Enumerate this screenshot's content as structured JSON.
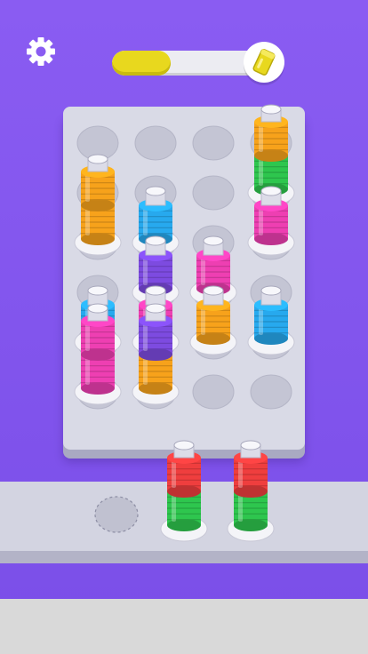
{
  "game": "color ring sort",
  "level_progress": 0.36,
  "colors": {
    "background": "#8a5cf2",
    "board": "#d9dae6",
    "hole": "#c4c5d4",
    "peg": "#dcdce8",
    "orange": "#f7a21b",
    "cyan": "#27a9ee",
    "magenta": "#ee3fb2",
    "purple": "#7d4be0",
    "green": "#2ec64e",
    "red": "#ef3e3e",
    "yellow": "#e8d81e"
  },
  "icons": {
    "settings": "gear-icon",
    "progress_badge": "paint-bucket-icon"
  },
  "board": {
    "columns": 4,
    "rows": 6,
    "pegs": [
      {
        "col": 0,
        "row": 1,
        "stack": [
          "orange",
          "orange"
        ]
      },
      {
        "col": 1,
        "row": 1,
        "stack": [
          "cyan"
        ]
      },
      {
        "col": 3,
        "row": 0,
        "stack": [
          "green",
          "orange"
        ]
      },
      {
        "col": 3,
        "row": 1,
        "stack": [
          "magenta"
        ]
      },
      {
        "col": 1,
        "row": 2,
        "stack": [
          "purple"
        ]
      },
      {
        "col": 2,
        "row": 2,
        "stack": [
          "magenta"
        ]
      },
      {
        "col": 0,
        "row": 3,
        "stack": [
          "cyan"
        ]
      },
      {
        "col": 1,
        "row": 3,
        "stack": [
          "magenta"
        ]
      },
      {
        "col": 2,
        "row": 3,
        "stack": [
          "orange"
        ]
      },
      {
        "col": 3,
        "row": 3,
        "stack": [
          "cyan"
        ]
      },
      {
        "col": 0,
        "row": 4,
        "stack": [
          "magenta",
          "magenta"
        ]
      },
      {
        "col": 1,
        "row": 4,
        "stack": [
          "orange",
          "purple"
        ]
      }
    ]
  },
  "tray": {
    "slots": [
      {
        "stack": []
      },
      {
        "stack": [
          "green",
          "red"
        ]
      },
      {
        "stack": [
          "green",
          "red"
        ]
      }
    ]
  }
}
